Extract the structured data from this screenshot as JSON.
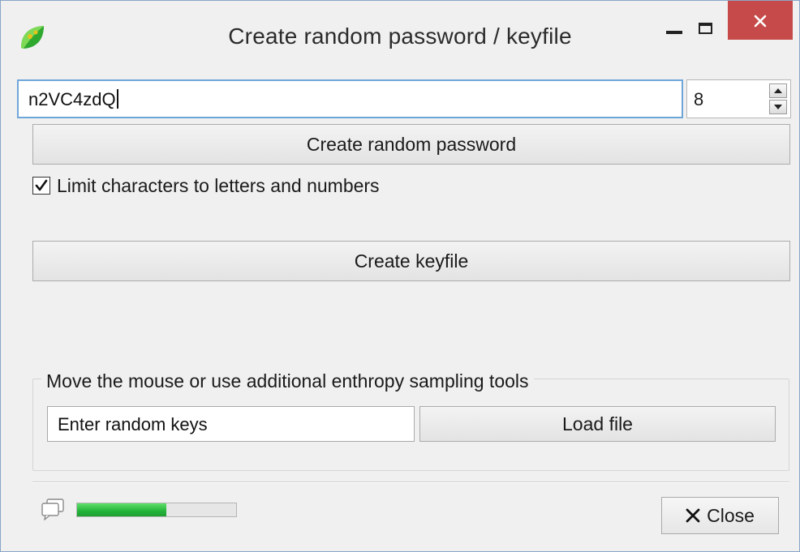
{
  "window": {
    "title": "Create random password / keyfile"
  },
  "password": {
    "value": "n2VC4zdQ",
    "length": "8",
    "create_button": "Create random password",
    "limit_checkbox_label": "Limit characters to letters and numbers",
    "limit_checked": true
  },
  "keyfile": {
    "create_button": "Create keyfile"
  },
  "entropy": {
    "group_label": "Move the mouse or use additional enthropy sampling tools",
    "random_keys_value": "Enter random keys",
    "load_file_button": "Load file"
  },
  "footer": {
    "progress_fraction": 0.56,
    "close_button": "Close"
  },
  "colors": {
    "close_titlebar": "#c74a4a",
    "progress_fill": "#24b33a",
    "focus_border": "#6fa6da"
  }
}
